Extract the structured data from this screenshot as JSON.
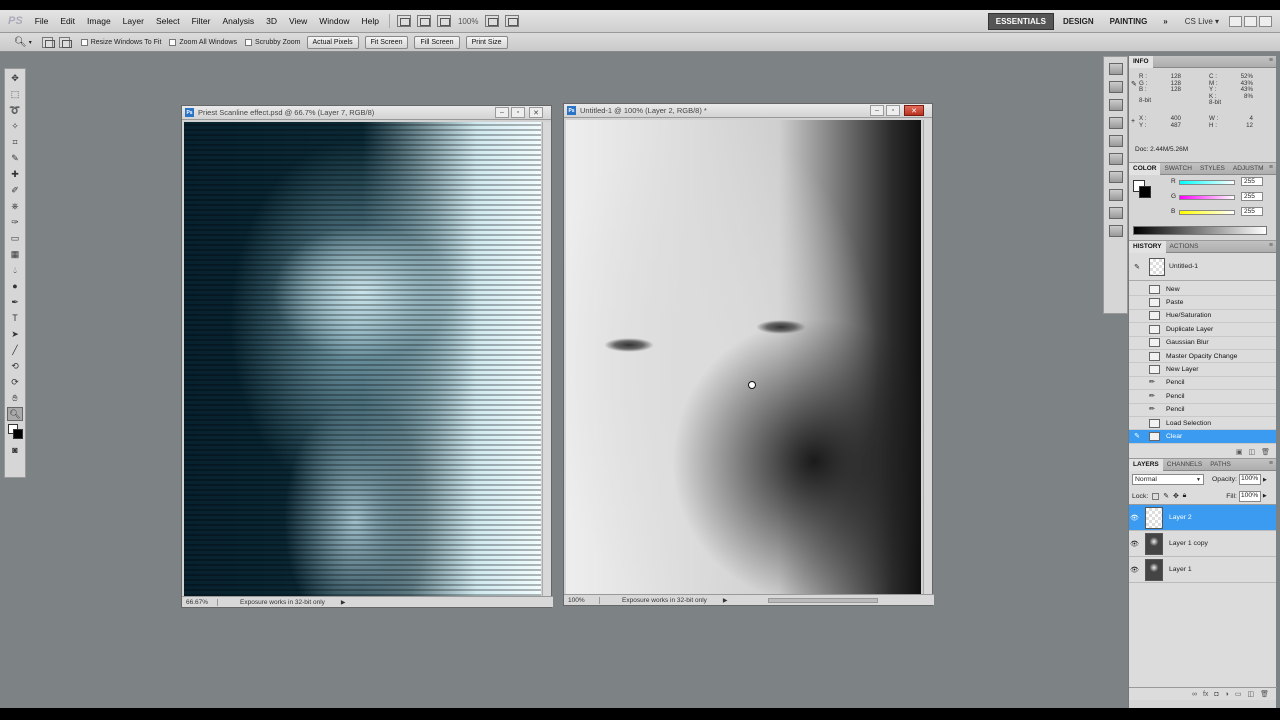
{
  "app": {
    "logo": "PS"
  },
  "menu": [
    "File",
    "Edit",
    "Image",
    "Layer",
    "Select",
    "Filter",
    "Analysis",
    "3D",
    "View",
    "Window",
    "Help"
  ],
  "menubar": {
    "zoom": "100%",
    "workspaces": [
      "ESSENTIALS",
      "DESIGN",
      "PAINTING"
    ],
    "more": "»",
    "cslive": "CS Live ▾"
  },
  "options": {
    "resize": "Resize Windows To Fit",
    "zoom_all": "Zoom All Windows",
    "scrubby": "Scrubby Zoom",
    "buttons": [
      "Actual Pixels",
      "Fit Screen",
      "Fill Screen",
      "Print Size"
    ]
  },
  "doc1": {
    "title": "Priest Scanline effect.psd @ 66.7% (Layer 7, RGB/8)",
    "zoom": "66.67%",
    "status": "Exposure works in 32-bit only"
  },
  "doc2": {
    "title": "Untitled-1 @ 100% (Layer 2, RGB/8) *",
    "zoom": "100%",
    "status": "Exposure works in 32-bit only"
  },
  "info": {
    "tab": "INFO",
    "rgb_labels": [
      "R :",
      "G :",
      "B :"
    ],
    "rgb_vals": [
      "128",
      "128",
      "128"
    ],
    "cmyk_labels": [
      "C :",
      "M :",
      "Y :",
      "K :"
    ],
    "cmyk_vals": [
      "52%",
      "43%",
      "43%",
      "8%"
    ],
    "bit_left": "8-bit",
    "bit_right": "8-bit",
    "xy_labels": [
      "X :",
      "Y :"
    ],
    "xy_vals": [
      "400",
      "487"
    ],
    "wh_labels": [
      "W :",
      "H :"
    ],
    "wh_vals": [
      "4",
      "12"
    ],
    "doc": "Doc: 2.44M/5.26M"
  },
  "color": {
    "tabs": [
      "COLOR",
      "SWATCH",
      "STYLES",
      "ADJUSTM"
    ],
    "labels": [
      "R",
      "G",
      "B"
    ],
    "values": [
      "255",
      "255",
      "255"
    ]
  },
  "history": {
    "tabs": [
      "HISTORY",
      "ACTIONS"
    ],
    "snapshot": "Untitled-1",
    "items": [
      "New",
      "Paste",
      "Hue/Saturation",
      "Duplicate Layer",
      "Gaussian Blur",
      "Master Opacity Change",
      "New Layer",
      "Pencil",
      "Pencil",
      "Pencil",
      "Load Selection",
      "Clear"
    ]
  },
  "layers": {
    "tabs": [
      "LAYERS",
      "CHANNELS",
      "PATHS"
    ],
    "blend": "Normal",
    "opacity_label": "Opacity:",
    "opacity": "100%",
    "lock_label": "Lock:",
    "fill_label": "Fill:",
    "fill": "100%",
    "items": [
      "Layer 2",
      "Layer 1 copy",
      "Layer 1"
    ]
  }
}
